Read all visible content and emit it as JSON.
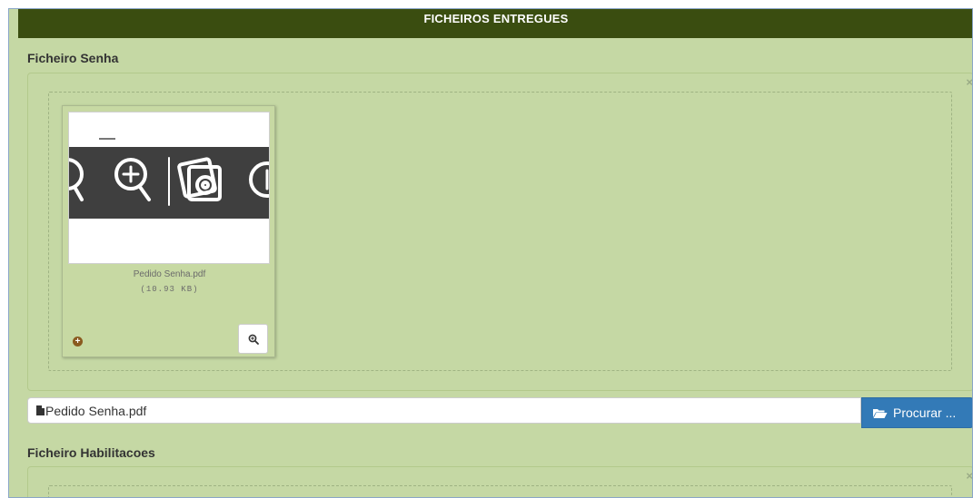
{
  "header": {
    "title": "FICHEIROS ENTREGUES"
  },
  "sections": [
    {
      "label": "Ficheiro Senha",
      "close_icon": "×",
      "file": {
        "name": "Pedido Senha.pdf",
        "size": "(10.93 KB)"
      },
      "input_value": "Pedido Senha.pdf",
      "browse_label": "Procurar ..."
    },
    {
      "label": "Ficheiro Habilitacoes",
      "close_icon": "×"
    }
  ],
  "icons": {
    "close": "close-icon",
    "drag": "plus-circle-icon",
    "zoom": "zoom-in-icon",
    "file": "file-icon",
    "folder": "folder-open-icon"
  },
  "colors": {
    "header_bg": "#3a4d10",
    "panel_bg": "#c5d8a4",
    "button_primary": "#337ab7",
    "drag_icon": "#8a5a1f"
  }
}
